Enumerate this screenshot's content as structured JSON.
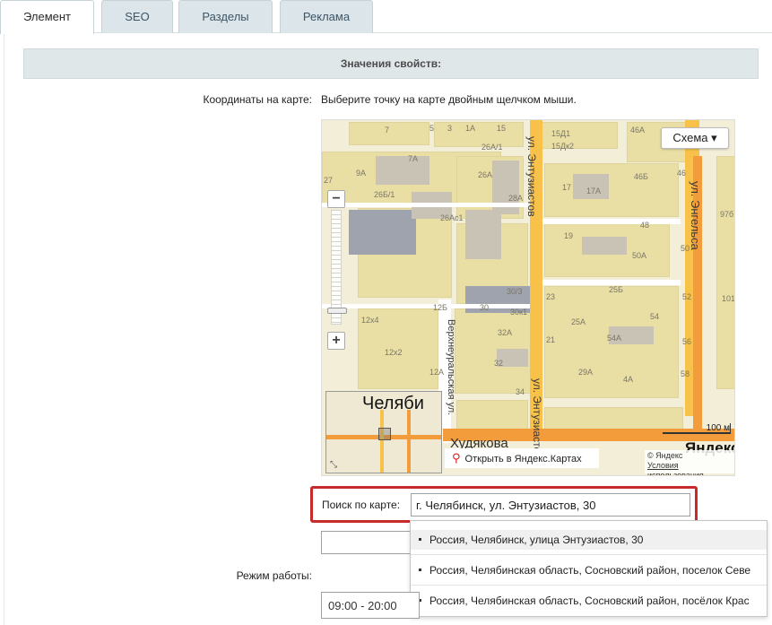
{
  "tabs": [
    {
      "label": "Элемент",
      "active": true
    },
    {
      "label": "SEO",
      "active": false
    },
    {
      "label": "Разделы",
      "active": false
    },
    {
      "label": "Реклама",
      "active": false
    }
  ],
  "section_title": "Значения свойств:",
  "coords": {
    "label": "Координаты на карте:",
    "hint": "Выберите точку на карте двойным щелчком мыши."
  },
  "map": {
    "layer_button": "Схема ▾",
    "streets": {
      "entuziastov_top": "ул. Энтузиастов",
      "entuziastov_bottom": "ул. Энтузиастов",
      "engelsa": "ул. Энгельса",
      "verkhneuralskaya": "Верхнеуральская ул.",
      "hulyakova": "Худякова"
    },
    "house_numbers": [
      "7",
      "5",
      "3",
      "1A",
      "15",
      "15Д1",
      "26А/1",
      "15Дк2",
      "46А",
      "7A",
      "26А",
      "9A",
      "26Б/1",
      "28А",
      "17",
      "17А",
      "46Б",
      "46",
      "27",
      "26Ас1",
      "19",
      "48",
      "50А",
      "50",
      "12Б",
      "30/3",
      "30",
      "30к1",
      "23",
      "25Б",
      "52",
      "12х4",
      "32А",
      "25А",
      "54",
      "12х2",
      "32",
      "21",
      "54А",
      "56",
      "12А",
      "34",
      "29А",
      "4А",
      "58",
      "97б",
      "101"
    ],
    "minimap_city": "Челяби",
    "open_in_yandex": "Открыть в Яндекс.Картах",
    "scale": "100 м",
    "copyright": "© Яндекс",
    "terms": "Условия использования",
    "logo": "Яндекс"
  },
  "search": {
    "label": "Поиск по карте:",
    "value": "г. Челябинск, ул. Энтузиастов, 30"
  },
  "suggestions": [
    "Россия, Челябинск, улица Энтузиастов, 30",
    "Россия, Челябинская область, Сосновский район, поселок Севе",
    "Россия, Челябинская область, Сосновский район, посёлок Крас"
  ],
  "work_mode": {
    "label": "Режим работы:",
    "value": "09:00 - 20:00"
  },
  "colors": {
    "tab_bg": "#dbe5ea",
    "highlight_border": "#c62a2a",
    "map_road": "#f8c24a",
    "map_main_road": "#f39c3b"
  }
}
